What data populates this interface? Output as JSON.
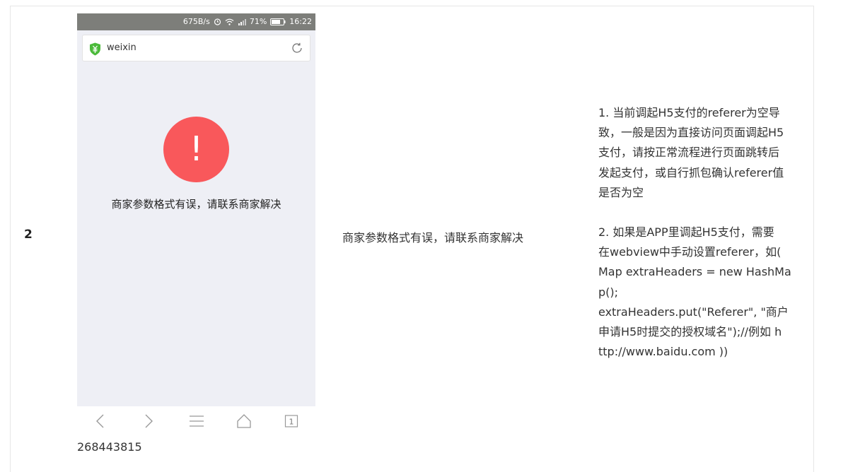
{
  "row": {
    "number": "2"
  },
  "phone": {
    "status": {
      "speed": "675B/s",
      "battery_pct": "71%",
      "time": "16:22"
    },
    "address": {
      "text": "weixin"
    },
    "alert_symbol": "!",
    "message": "商家参数格式有误，请联系商家解决",
    "tab_count": "1"
  },
  "caption": "268443815",
  "description": "商家参数格式有误，请联系商家解决",
  "solution": {
    "p1": [
      "1. 当前调起H5支付的referer为空导",
      "致，一般是因为直接访问页面调起H5",
      "支付，请按正常流程进行页面跳转后",
      "发起支付，或自行抓包确认referer值",
      "是否为空"
    ],
    "p2": [
      "2. 如果是APP里调起H5支付，需要",
      "在webview中手动设置referer，如(",
      "Map extraHeaders = new HashMa",
      "p();",
      "extraHeaders.put(\"Referer\", \"商户",
      "申请H5时提交的授权域名\");//例如 h",
      "ttp://www.baidu.com ))"
    ]
  },
  "colors": {
    "alert": "#f9585b",
    "statusbar": "#7d7e7a",
    "shield": "#4bba3a",
    "page_bg": "#eeeff5"
  }
}
